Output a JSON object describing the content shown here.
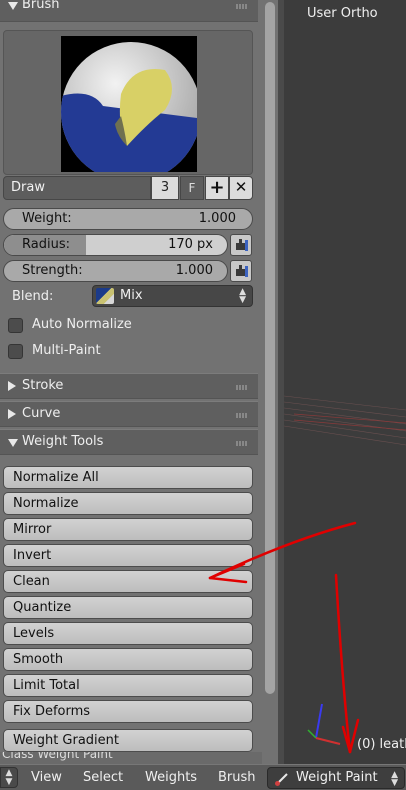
{
  "brush_panel": {
    "title": "Brush",
    "brush_name": "Draw",
    "users_count": "3",
    "fake_user_label": "F",
    "weight": {
      "label": "Weight:",
      "value": "1.000"
    },
    "radius": {
      "label": "Radius:",
      "value": "170 px"
    },
    "strength": {
      "label": "Strength:",
      "value": "1.000"
    },
    "blend": {
      "label": "Blend:",
      "value": "Mix"
    },
    "auto_normalize": {
      "label": "Auto Normalize",
      "checked": false
    },
    "multi_paint": {
      "label": "Multi-Paint",
      "checked": false
    }
  },
  "panels": {
    "stroke": "Stroke",
    "curve": "Curve",
    "weight_tools": "Weight Tools"
  },
  "weight_tools": [
    "Normalize All",
    "Normalize",
    "Mirror",
    "Invert",
    "Clean",
    "Quantize",
    "Levels",
    "Smooth",
    "Limit Total",
    "Fix Deforms",
    "Weight Gradient"
  ],
  "cut_off_label": "Class Weight Paint",
  "viewport": {
    "view_name": "User Ortho",
    "object_info": "(0) leath"
  },
  "bottom_bar": {
    "menus": [
      "View",
      "Select",
      "Weights",
      "Brush"
    ],
    "mode": "Weight Paint"
  },
  "icons": {
    "preview": "brush-preview-sphere",
    "add": "plus-icon",
    "unlink": "x-icon",
    "pressure": "pressure-hand-icon",
    "blend_swatch": "blend-swatch-icon",
    "mode": "paintbrush-icon"
  },
  "colors": {
    "panel_bg": "#727272",
    "viewport_bg": "#3c3c3c",
    "annotation_red": "#e00000"
  }
}
